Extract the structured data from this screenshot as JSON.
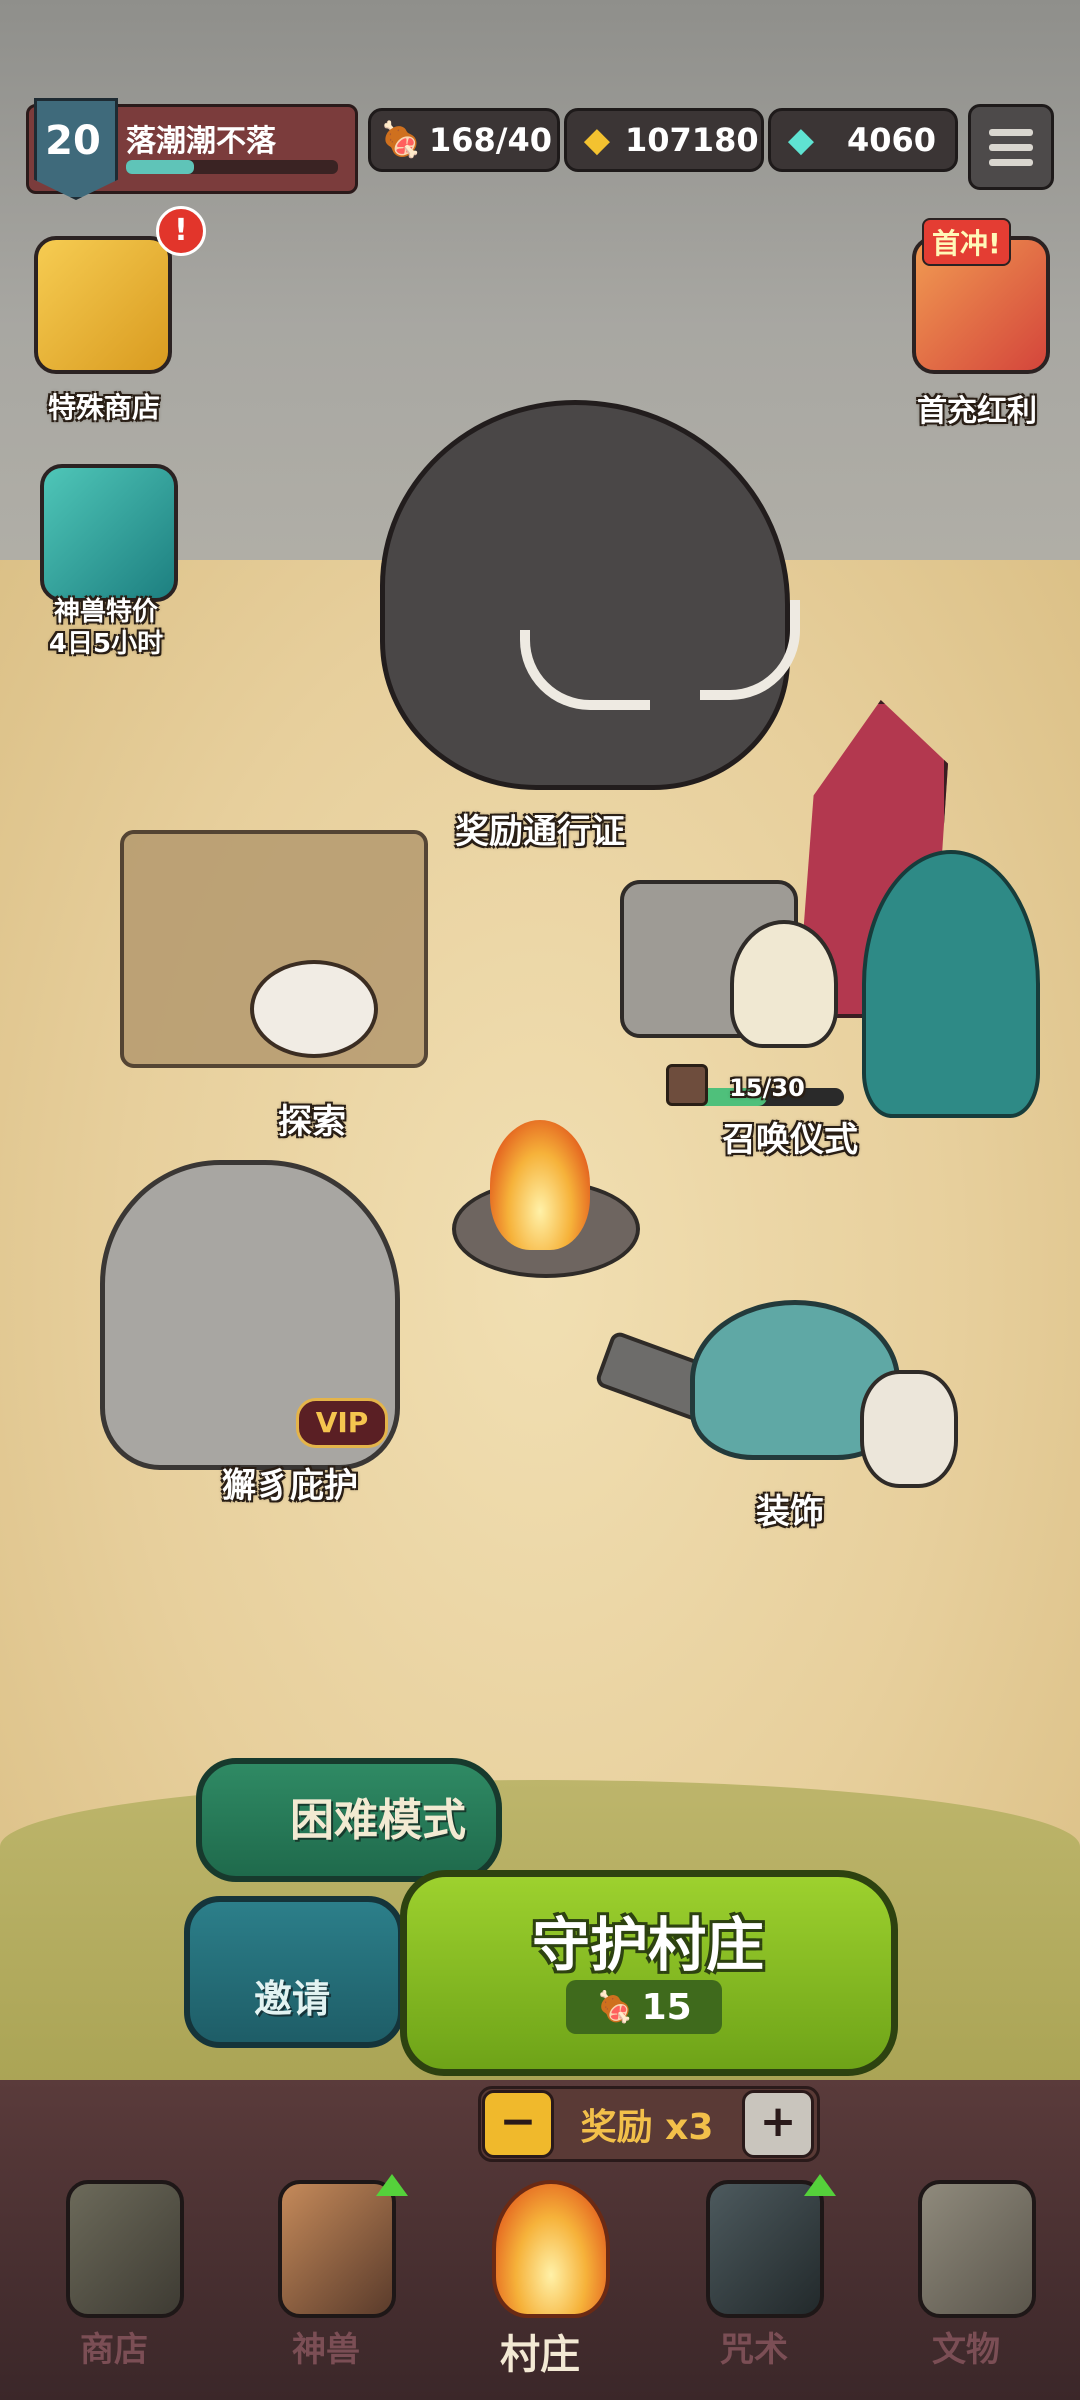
{
  "player": {
    "level": "20",
    "name": "落潮潮不落",
    "xp_fraction": 0.32
  },
  "resources": {
    "meat": {
      "icon": "meat-icon",
      "value": "168/40"
    },
    "gold": {
      "icon": "gold-ore-icon",
      "value": "107180"
    },
    "gem": {
      "icon": "gem-icon",
      "value": "4060"
    }
  },
  "side_left": {
    "special_shop": "特殊商店",
    "beast_deal": "神兽特价",
    "beast_deal_timer": "4日5小时",
    "alert": "!"
  },
  "side_right": {
    "first_charge_tag": "首冲!",
    "first_charge_label": "首充红利"
  },
  "stations": {
    "reward_pass": "奖励通行证",
    "explore": "探索",
    "summon": "召唤仪式",
    "summon_progress": "15/30",
    "summon_fraction": 0.5,
    "lion": "獬豸庇护",
    "vip": "VIP",
    "decor": "装饰"
  },
  "actions": {
    "hard_mode": "困难模式",
    "invite": "邀请",
    "guard_village": "守护村庄",
    "guard_cost": "15",
    "reward_multiplier": "奖励 x3",
    "minus": "−",
    "plus": "+"
  },
  "nav": [
    {
      "label": "商店",
      "icon": "shop-icon",
      "active": false
    },
    {
      "label": "神兽",
      "icon": "beast-icon",
      "active": false
    },
    {
      "label": "村庄",
      "icon": "campfire-icon",
      "active": true
    },
    {
      "label": "咒术",
      "icon": "spell-icon",
      "active": false
    },
    {
      "label": "文物",
      "icon": "scroll-icon",
      "active": false
    }
  ],
  "colors": {
    "accent_green": "#8fc425",
    "nav_active": "#f3e9d4",
    "nav_inactive": "#7b4e55"
  }
}
